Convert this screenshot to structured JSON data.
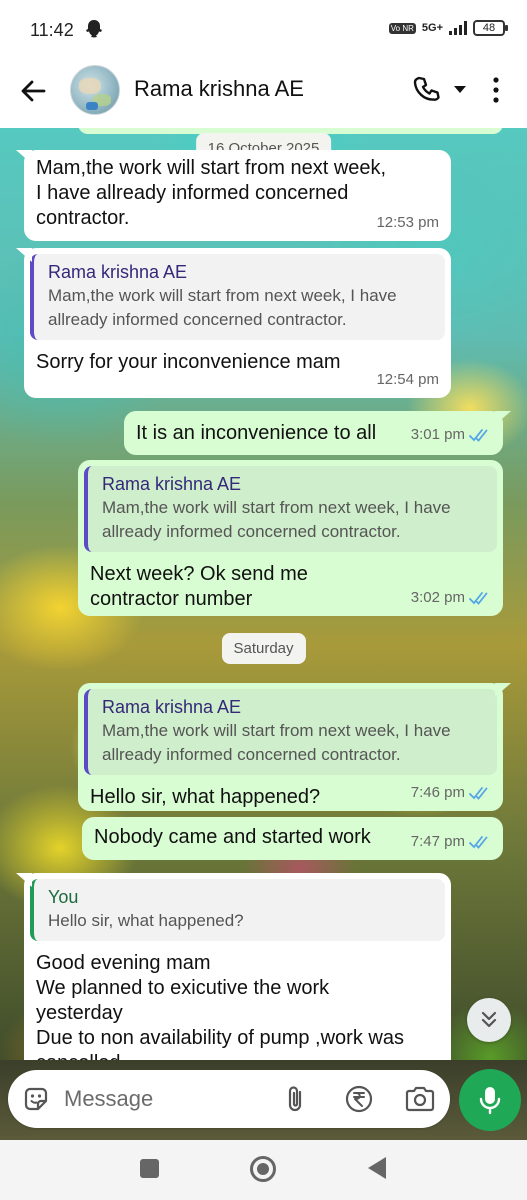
{
  "status_bar": {
    "time": "11:42",
    "network": "5G+",
    "volte": "Vo NR",
    "battery": "48"
  },
  "header": {
    "contact_name": "Rama krishna AE"
  },
  "chat": {
    "dates": [
      "16 October 2025",
      "Saturday"
    ],
    "messages": [
      {
        "text": "Mam,the work will start from next week,\nI have allready informed concerned\ncontractor.",
        "time": "12:53 pm"
      },
      {
        "quote_name": "Rama krishna AE",
        "quote_text": "Mam,the work will start from next week, I have allready informed concerned contractor.",
        "text": "Sorry for your inconvenience mam",
        "time": "12:54 pm"
      },
      {
        "text": "It is an inconvenience to all",
        "time": "3:01 pm"
      },
      {
        "quote_name": "Rama krishna AE",
        "quote_text": "Mam,the work will start from next week, I have allready informed concerned contractor.",
        "text": "Next week? Ok send me contractor number",
        "time": "3:02 pm"
      },
      {
        "quote_name": "Rama krishna AE",
        "quote_text": "Mam,the work will start from next week, I have allready informed concerned contractor.",
        "text": "Hello sir, what happened?",
        "time": "7:46 pm"
      },
      {
        "text": "Nobody came and started work",
        "time": "7:47 pm"
      },
      {
        "quote_name": "You",
        "quote_text": "Hello sir, what happened?",
        "text": "Good evening mam\nWe planned to exicutive the work\nyesterday\nDue to non availability of pump ,work was\ncancelled"
      }
    ]
  },
  "composer": {
    "placeholder": "Message"
  },
  "icons": {
    "back": "arrow-left-icon",
    "call": "phone-icon",
    "call_menu": "caret-down-icon",
    "more": "more-vert-icon",
    "scroll": "double-chevron-down-icon",
    "emoji": "sticker-icon",
    "attach": "paperclip-icon",
    "payment": "rupee-icon",
    "camera": "camera-icon",
    "mic": "mic-icon"
  },
  "colors": {
    "incoming_bubble": "#ffffff",
    "outgoing_bubble": "#d9fdd3",
    "read_ticks": "#53a6e6",
    "mic_button": "#1fa855",
    "quote_bar_contact": "#5b4bc4",
    "quote_bar_you": "#1f9c57"
  }
}
